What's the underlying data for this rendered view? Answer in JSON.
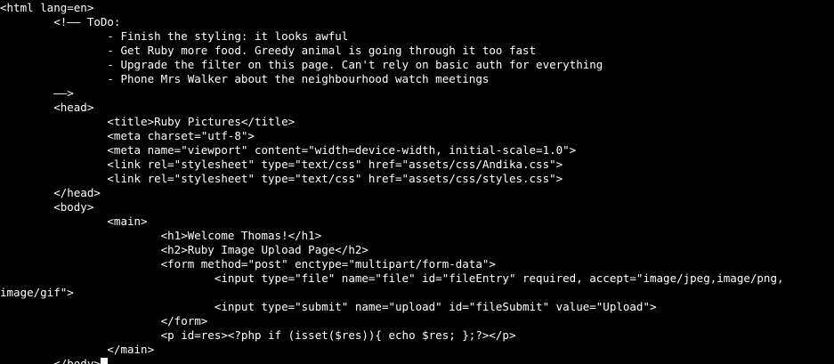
{
  "terminal": {
    "lines": [
      "<html lang=en>",
      "        <!—— ToDo:",
      "                - Finish the styling: it looks awful",
      "                - Get Ruby more food. Greedy animal is going through it too fast",
      "                - Upgrade the filter on this page. Can't rely on basic auth for everything",
      "                - Phone Mrs Walker about the neighbourhood watch meetings",
      "        ——>",
      "        <head>",
      "                <title>Ruby Pictures</title>",
      "                <meta charset=\"utf-8\">",
      "                <meta name=\"viewport\" content=\"width=device-width, initial-scale=1.0\">",
      "                <link rel=\"stylesheet\" type=\"text/css\" href=\"assets/css/Andika.css\">",
      "                <link rel=\"stylesheet\" type=\"text/css\" href=\"assets/css/styles.css\">",
      "        </head>",
      "        <body>",
      "                <main>",
      "                        <h1>Welcome Thomas!</h1>",
      "                        <h2>Ruby Image Upload Page</h2>",
      "                        <form method=\"post\" enctype=\"multipart/form-data\">",
      "                                <input type=\"file\" name=\"file\" id=\"fileEntry\" required, accept=\"image/jpeg,image/png,",
      "image/gif\">",
      "                                <input type=\"submit\" name=\"upload\" id=\"fileSubmit\" value=\"Upload\">",
      "                        </form>",
      "                        <p id=res><?php if (isset($res)){ echo $res; };?></p>",
      "                </main>",
      "        </body>"
    ]
  },
  "colors": {
    "background": "#000000",
    "foreground": "#ffffff"
  }
}
